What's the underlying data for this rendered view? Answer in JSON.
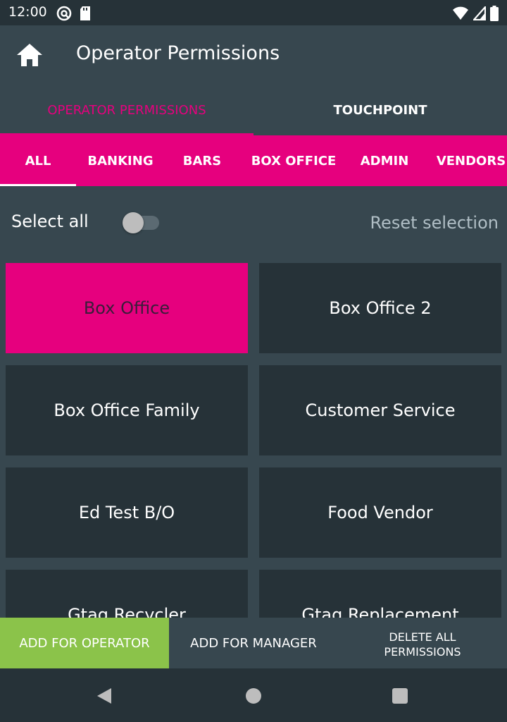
{
  "status_bar": {
    "time": "12:00",
    "left_icons": [
      "at-sign-icon",
      "sd-card-icon"
    ],
    "right_icons": [
      "wifi-icon",
      "signal-icon",
      "battery-icon"
    ]
  },
  "app_bar": {
    "title": "Operator Permissions",
    "home_icon": "home-icon"
  },
  "primary_tabs": [
    {
      "label": "OPERATOR PERMISSIONS",
      "active": true
    },
    {
      "label": "TOUCHPOINT",
      "active": false
    }
  ],
  "category_tabs": [
    {
      "label": "ALL",
      "active": true
    },
    {
      "label": "BANKING",
      "active": false
    },
    {
      "label": "BARS",
      "active": false
    },
    {
      "label": "BOX OFFICE",
      "active": false
    },
    {
      "label": "ADMIN",
      "active": false
    },
    {
      "label": "VENDORS",
      "active": false
    }
  ],
  "select_row": {
    "select_all_label": "Select all",
    "toggle_on": false,
    "reset_label": "Reset selection"
  },
  "tiles": [
    {
      "label": "Box Office",
      "selected": true
    },
    {
      "label": "Box Office 2",
      "selected": false
    },
    {
      "label": "Box Office Family",
      "selected": false
    },
    {
      "label": "Customer Service",
      "selected": false
    },
    {
      "label": "Ed Test B/O",
      "selected": false
    },
    {
      "label": "Food Vendor",
      "selected": false
    },
    {
      "label": "Gtag Recycler",
      "selected": false
    },
    {
      "label": "Gtag Replacement",
      "selected": false
    }
  ],
  "actions": {
    "add_operator": "ADD FOR OPERATOR",
    "add_manager": "ADD FOR MANAGER",
    "delete_all_line1": "DELETE ALL",
    "delete_all_line2": "PERMISSIONS"
  },
  "colors": {
    "accent": "#e6007e",
    "primary_action": "#8bc34a",
    "background": "#37474f",
    "tile": "#263238"
  }
}
